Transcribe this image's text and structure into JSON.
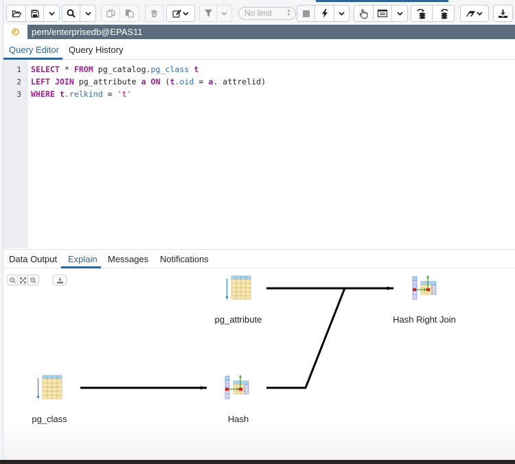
{
  "toolbar": {
    "groups": [
      {
        "buttons": [
          "open-file-icon",
          "save-icon",
          "chevron-down-icon"
        ]
      },
      {
        "buttons": [
          "search-icon",
          "chevron-down-icon"
        ]
      },
      {
        "buttons": [
          "copy-icon",
          "paste-icon"
        ],
        "disabled": true
      },
      {
        "buttons": [
          "delete-icon"
        ],
        "disabled": true
      },
      {
        "buttons": [
          "edit-icon",
          "chevron-down-icon"
        ]
      },
      {
        "buttons": [
          "filter-icon",
          "chevron-down-icon"
        ],
        "disabled": true
      },
      {
        "buttons": [
          "stop-icon",
          "execute-icon",
          "chevron-down-icon"
        ]
      },
      {
        "buttons": [
          "explain-icon",
          "explain-analyze-icon",
          "chevron-down-icon"
        ]
      },
      {
        "buttons": [
          "commit-icon",
          "rollback-icon"
        ]
      },
      {
        "buttons": [
          "clear-icon",
          "chevron-down-icon"
        ]
      },
      {
        "buttons": [
          "download-icon"
        ]
      }
    ],
    "limit_placeholder": "No limit"
  },
  "connection": {
    "status_color": "#f0a030",
    "label": "pem/enterprisedb@EPAS11"
  },
  "editor_tabs": [
    {
      "label": "Query Editor",
      "active": true
    },
    {
      "label": "Query History",
      "active": false
    }
  ],
  "editor": {
    "line_numbers": [
      "1",
      "2",
      "3"
    ],
    "lines": [
      [
        {
          "t": "SELECT",
          "c": "kw"
        },
        {
          "t": " * ",
          "c": "op"
        },
        {
          "t": "FROM",
          "c": "kw"
        },
        {
          "t": " pg_catalog.",
          "c": "ident"
        },
        {
          "t": "pg_class",
          "c": "prop"
        },
        {
          "t": " ",
          "c": "op"
        },
        {
          "t": "t",
          "c": "alias"
        }
      ],
      [
        {
          "t": "LEFT JOIN",
          "c": "kw"
        },
        {
          "t": " pg_attribute ",
          "c": "ident"
        },
        {
          "t": "a",
          "c": "alias"
        },
        {
          "t": " ",
          "c": "op"
        },
        {
          "t": "ON",
          "c": "kw"
        },
        {
          "t": " (",
          "c": "op"
        },
        {
          "t": "t",
          "c": "alias"
        },
        {
          "t": ".oid",
          "c": "prop"
        },
        {
          "t": " = ",
          "c": "op"
        },
        {
          "t": "a",
          "c": "alias"
        },
        {
          "t": ". attrelid)",
          "c": "ident"
        }
      ],
      [
        {
          "t": "WHERE",
          "c": "kw"
        },
        {
          "t": " ",
          "c": "op"
        },
        {
          "t": "t",
          "c": "alias"
        },
        {
          "t": ".relkind",
          "c": "prop"
        },
        {
          "t": " = ",
          "c": "op"
        },
        {
          "t": "'t'",
          "c": "str"
        }
      ]
    ]
  },
  "results_tabs": [
    {
      "label": "Data Output",
      "active": false
    },
    {
      "label": "Explain",
      "active": true
    },
    {
      "label": "Messages",
      "active": false
    },
    {
      "label": "Notifications",
      "active": false
    }
  ],
  "explain": {
    "zoom_controls": [
      "zoom-in-icon",
      "zoom-fit-icon",
      "zoom-out-icon"
    ],
    "download_icon": "download-icon",
    "nodes": [
      {
        "id": "pg_attribute",
        "label": "pg_attribute",
        "type": "seq-scan"
      },
      {
        "id": "hash_right_join",
        "label": "Hash Right Join",
        "type": "hash-join"
      },
      {
        "id": "pg_class",
        "label": "pg_class",
        "type": "seq-scan"
      },
      {
        "id": "hash",
        "label": "Hash",
        "type": "hash"
      }
    ],
    "edges": [
      {
        "from": "pg_attribute",
        "to": "hash_right_join"
      },
      {
        "from": "pg_class",
        "to": "hash"
      },
      {
        "from": "hash",
        "to": "hash_right_join"
      }
    ]
  }
}
